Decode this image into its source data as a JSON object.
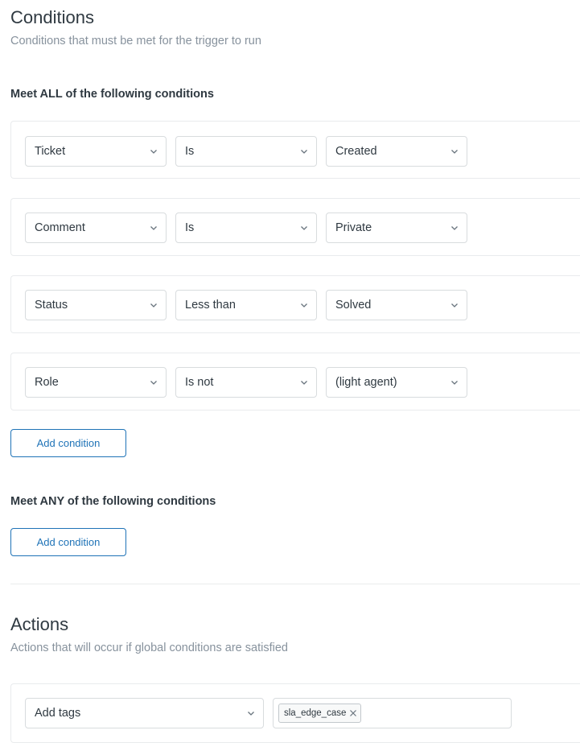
{
  "conditions": {
    "title": "Conditions",
    "subtitle": "Conditions that must be met for the trigger to run",
    "all": {
      "heading": "Meet ALL of the following conditions",
      "rows": [
        {
          "field": "Ticket",
          "operator": "Is",
          "value": "Created"
        },
        {
          "field": "Comment",
          "operator": "Is",
          "value": "Private"
        },
        {
          "field": "Status",
          "operator": "Less than",
          "value": "Solved"
        },
        {
          "field": "Role",
          "operator": "Is not",
          "value": "(light agent)"
        }
      ],
      "add_button": "Add condition"
    },
    "any": {
      "heading": "Meet ANY of the following conditions",
      "add_button": "Add condition"
    }
  },
  "actions": {
    "title": "Actions",
    "subtitle": "Actions that will occur if global conditions are satisfied",
    "rows": [
      {
        "action": "Add tags",
        "tags": [
          "sla_edge_case"
        ]
      }
    ]
  },
  "icons": {
    "select_chevron": "chevron-down-icon",
    "tag_remove": "close-icon"
  },
  "colors": {
    "primary_blue": "#1f73b7",
    "text": "#2f3941",
    "muted_text": "#87929d",
    "border": "#d8dcde",
    "card_border": "#e9ebed"
  }
}
